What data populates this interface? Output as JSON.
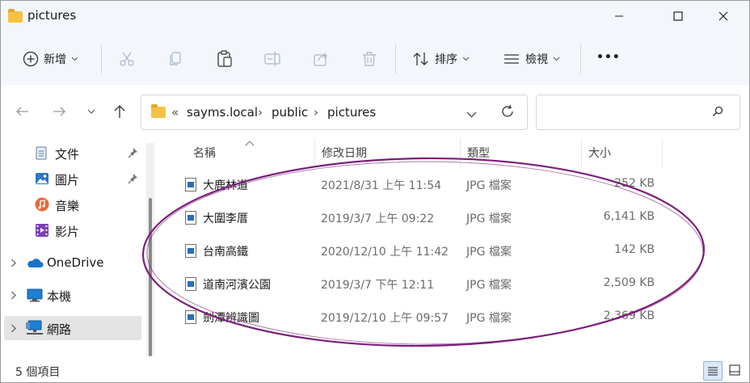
{
  "window": {
    "title": "pictures"
  },
  "titlebar_controls": {
    "minimize": "—",
    "maximize": "☐",
    "close": "✕"
  },
  "toolbar": {
    "new_label": "新增",
    "sort_label": "排序",
    "view_label": "檢視",
    "more_label": "•••",
    "icons": [
      "new-icon",
      "cut-icon",
      "copy-icon",
      "paste-icon",
      "rename-icon",
      "share-icon",
      "delete-icon",
      "sort-icon",
      "view-icon",
      "more-icon"
    ]
  },
  "navigation": {
    "back": "←",
    "forward": "→",
    "recent": "⌄",
    "up": "↑"
  },
  "address": {
    "overflow": "«",
    "crumbs": [
      "sayms.local",
      "public",
      "pictures"
    ],
    "separator": "›"
  },
  "search": {
    "placeholder": ""
  },
  "sidebar": {
    "quick": [
      {
        "label": "文件",
        "icon": "documents-icon",
        "pinned": true
      },
      {
        "label": "圖片",
        "icon": "pictures-icon",
        "pinned": true
      },
      {
        "label": "音樂",
        "icon": "music-icon",
        "pinned": false
      },
      {
        "label": "影片",
        "icon": "videos-icon",
        "pinned": false
      }
    ],
    "roots": [
      {
        "label": "OneDrive",
        "icon": "onedrive-icon"
      },
      {
        "label": "本機",
        "icon": "this-pc-icon"
      },
      {
        "label": "網路",
        "icon": "network-icon",
        "selected": true
      }
    ]
  },
  "columns": {
    "name": "名稱",
    "modified": "修改日期",
    "type": "類型",
    "size": "大小"
  },
  "files": [
    {
      "name": "大鹿林道",
      "modified": "2021/8/31 上午 11:54",
      "type": "JPG 檔案",
      "size": "252 KB"
    },
    {
      "name": "大圍李厝",
      "modified": "2019/3/7 上午 09:22",
      "type": "JPG 檔案",
      "size": "6,141 KB"
    },
    {
      "name": "台南高鐵",
      "modified": "2020/12/10 上午 11:42",
      "type": "JPG 檔案",
      "size": "142 KB"
    },
    {
      "name": "道南河濱公園",
      "modified": "2019/3/7 下午 12:11",
      "type": "JPG 檔案",
      "size": "2,509 KB"
    },
    {
      "name": "劍潭辨識圖",
      "modified": "2019/12/10 上午 09:57",
      "type": "JPG 檔案",
      "size": "2,369 KB"
    }
  ],
  "status": {
    "item_count": "5 個項目"
  },
  "colors": {
    "accent": "#0067c0",
    "annotation": "#7a1f7a",
    "chrome": "#f3f6fb",
    "folder": "#f6c244"
  }
}
